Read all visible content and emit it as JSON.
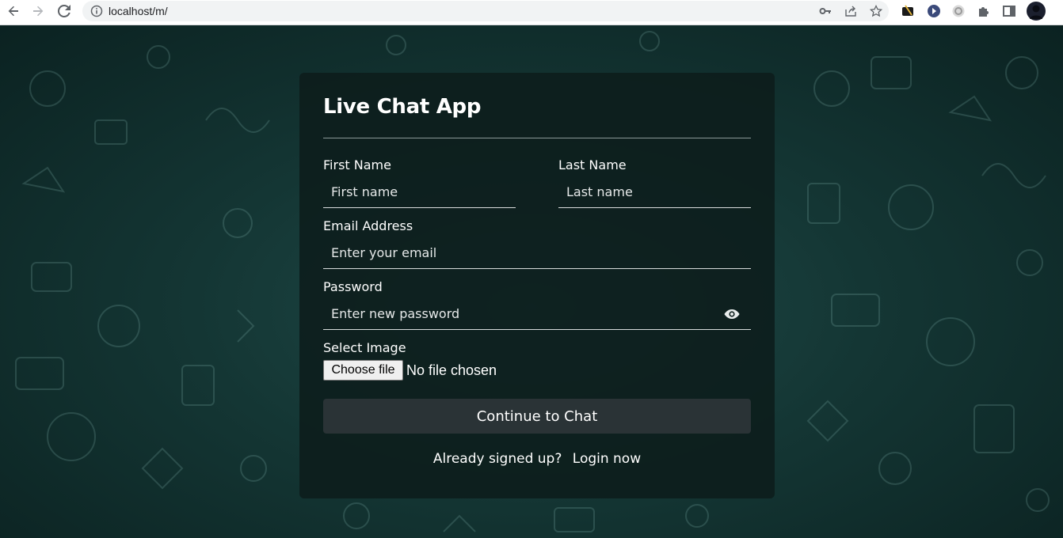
{
  "browser": {
    "url": "localhost/m/",
    "icons": [
      "back-icon",
      "forward-icon",
      "reload-icon",
      "info-icon",
      "key-icon",
      "share-icon",
      "star-icon",
      "extension-icon",
      "extensions-puzzle-icon",
      "side-panel-icon",
      "profile-avatar"
    ]
  },
  "form": {
    "title": "Live Chat App",
    "first_name_label": "First Name",
    "first_name_placeholder": "First name",
    "last_name_label": "Last Name",
    "last_name_placeholder": "Last name",
    "email_label": "Email Address",
    "email_placeholder": "Enter your email",
    "password_label": "Password",
    "password_placeholder": "Enter new password",
    "image_label": "Select Image",
    "choose_file_label": "Choose file",
    "no_file_text": "No file chosen",
    "submit_label": "Continue to Chat",
    "already_text": "Already signed up?",
    "login_link": "Login now"
  },
  "colors": {
    "background": "#143634",
    "card": "#0c1c1b",
    "button": "#2a3336",
    "text": "#ffffff"
  }
}
